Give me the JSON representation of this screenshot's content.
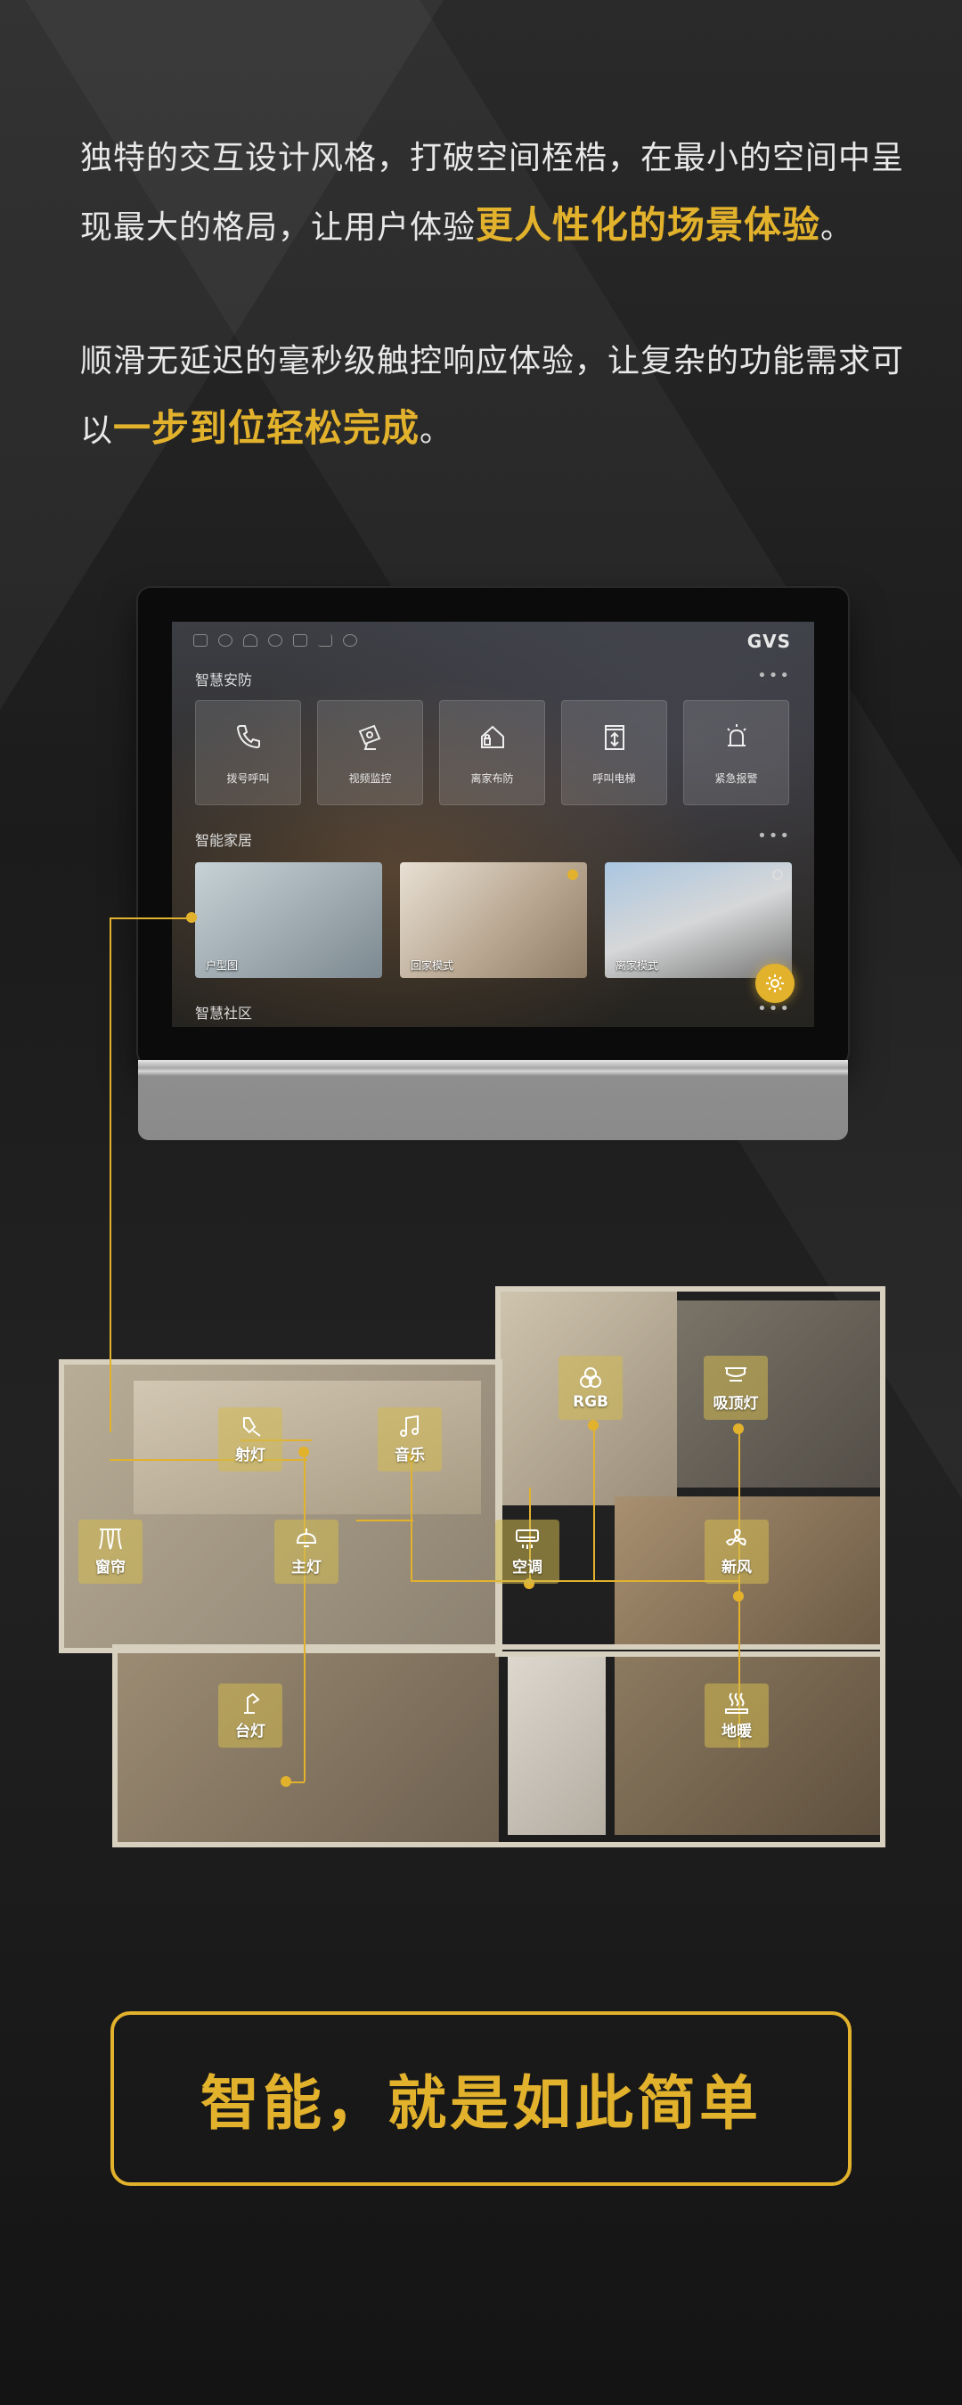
{
  "intro": {
    "p1_text": "独特的交互设计风格，打破空间桎梏，在最小的空间中呈现最大的格局，让用户体验",
    "p1_highlight": "更人性化的场景体验",
    "p1_end": "。",
    "p2_text": "顺滑无延迟的毫秒级触控响应体验，让复杂的功能需求可以",
    "p2_highlight": "一步到位轻松完成",
    "p2_end": "。"
  },
  "tablet": {
    "brand": "GVS",
    "more_glyph": "•••",
    "security": {
      "title": "智慧安防",
      "tiles": [
        {
          "label": "拨号呼叫",
          "icon": "phone-icon"
        },
        {
          "label": "视频监控",
          "icon": "camera-icon"
        },
        {
          "label": "离家布防",
          "icon": "home-lock-icon"
        },
        {
          "label": "呼叫电梯",
          "icon": "elevator-icon"
        },
        {
          "label": "紧急报警",
          "icon": "alarm-icon"
        }
      ]
    },
    "home": {
      "title": "智能家居",
      "cards": [
        {
          "label": "户型图"
        },
        {
          "label": "回家模式"
        },
        {
          "label": "离家模式"
        }
      ]
    },
    "community": {
      "title": "智慧社区"
    }
  },
  "floorplan": {
    "controls": [
      {
        "key": "curtain",
        "label": "窗帘",
        "icon": "curtain-icon"
      },
      {
        "key": "spotlight",
        "label": "射灯",
        "icon": "spotlight-icon"
      },
      {
        "key": "music",
        "label": "音乐",
        "icon": "music-icon"
      },
      {
        "key": "rgb",
        "label": "RGB",
        "icon": "rgb-icon"
      },
      {
        "key": "ceiling",
        "label": "吸顶灯",
        "icon": "ceiling-light-icon"
      },
      {
        "key": "main",
        "label": "主灯",
        "icon": "pendant-light-icon"
      },
      {
        "key": "ac",
        "label": "空调",
        "icon": "air-conditioner-icon"
      },
      {
        "key": "fresh",
        "label": "新风",
        "icon": "fan-icon"
      },
      {
        "key": "desk",
        "label": "台灯",
        "icon": "desk-lamp-icon"
      },
      {
        "key": "floor",
        "label": "地暖",
        "icon": "floor-heating-icon"
      }
    ]
  },
  "slogan": "智能，就是如此简单",
  "colors": {
    "accent": "#e3b22c",
    "background": "#1b1b1b"
  }
}
